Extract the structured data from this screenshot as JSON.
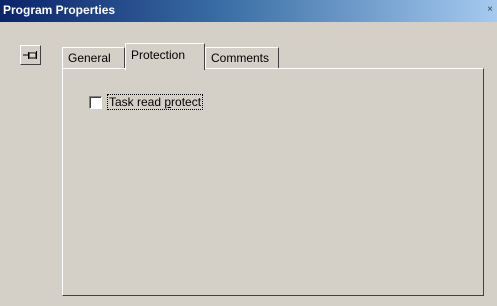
{
  "window": {
    "title": "Program Properties",
    "close_glyph": "×"
  },
  "pin": {
    "icon": "pushpin-icon"
  },
  "tabs": [
    {
      "label": "General",
      "active": false
    },
    {
      "label": "Protection",
      "active": true
    },
    {
      "label": "Comments",
      "active": false
    }
  ],
  "protection": {
    "task_read_protect": {
      "label_pre": "Task read ",
      "label_accel": "p",
      "label_post": "rotect",
      "checked": false
    }
  }
}
